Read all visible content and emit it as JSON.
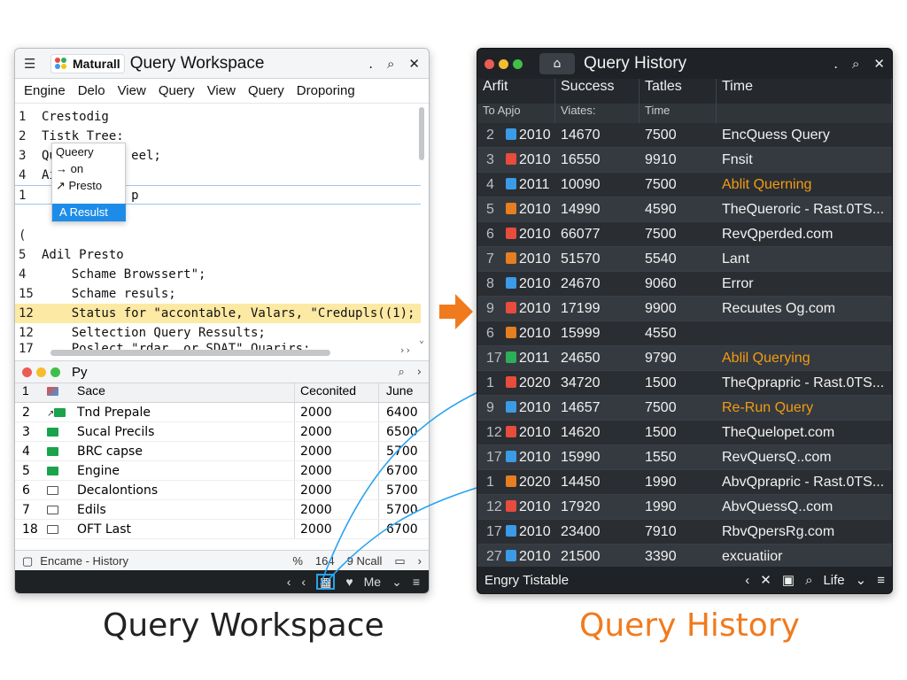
{
  "left_window": {
    "app_name": "Maturall",
    "title": "Query Workspace",
    "title_controls": [
      ".",
      "⌕",
      "✕"
    ],
    "menu": [
      "Engine",
      "Delo",
      "View",
      "Query",
      "View",
      "Query",
      "Droporing"
    ],
    "editor_lines": [
      {
        "ln": "1",
        "text": "Crestodig"
      },
      {
        "ln": "2",
        "text": "Tistk Tree:"
      },
      {
        "ln": "3",
        "text": "Queery      eel;"
      },
      {
        "ln": "4",
        "text": "Ai"
      },
      {
        "ln": "1",
        "text": "            p"
      },
      {
        "ln": "(",
        "text": ""
      },
      {
        "ln": "5",
        "text": "Adil Presto"
      },
      {
        "ln": "4",
        "text": "    Schame Browssert\";"
      },
      {
        "ln": "15",
        "text": "    Schame resuls;"
      },
      {
        "ln": "12",
        "text": "    Status for \"accontable, Valars, \"Credupls((1);"
      },
      {
        "ln": "12",
        "text": "    Seltection Query Ressults;"
      },
      {
        "ln": "17",
        "text": "    Poslect \"rdar, or SDAT\" Quarirs;"
      },
      {
        "ln": "23",
        "text": ")"
      }
    ],
    "popup_items": [
      "Queery",
      "→ on",
      "↗ Presto"
    ],
    "popup_active": "A Resulst",
    "sub_title": "Py",
    "files_header": [
      "Sace",
      "Ceconited",
      "June"
    ],
    "files": [
      {
        "n": "1",
        "icon": "image-icon",
        "name": "",
        "c": "",
        "j": ""
      },
      {
        "n": "2",
        "icon": "folder-green",
        "name": "Tnd Prepale",
        "c": "2000",
        "j": "6400"
      },
      {
        "n": "3",
        "icon": "folder-green",
        "name": "Sucal Precils",
        "c": "2000",
        "j": "6500"
      },
      {
        "n": "4",
        "icon": "folder-green",
        "name": "BRC capse",
        "c": "2000",
        "j": "5700"
      },
      {
        "n": "5",
        "icon": "folder-green",
        "name": "Engine",
        "c": "2000",
        "j": "6700"
      },
      {
        "n": "6",
        "icon": "folder-outline",
        "name": "Decalontions",
        "c": "2000",
        "j": "5700"
      },
      {
        "n": "7",
        "icon": "folder-outline",
        "name": "Edils",
        "c": "2000",
        "j": "5700"
      },
      {
        "n": "18",
        "icon": "folder-outline",
        "name": "OFT Last",
        "c": "2000",
        "j": "6700"
      }
    ],
    "status_left": "Encame - History",
    "status_right": [
      "164",
      "9  Ncall"
    ],
    "bottom_label": "Me"
  },
  "right_window": {
    "title": "Query History",
    "headers": [
      "Arfit",
      "Success",
      "Tatles",
      "Time"
    ],
    "subheaders": [
      "To Apjo",
      "Viates:",
      "Time",
      ""
    ],
    "rows": [
      {
        "n": "2",
        "icon": "b",
        "year": "2010",
        "s": "14670",
        "t": "7500",
        "d": "EncQuess Query",
        "hl": false
      },
      {
        "n": "3",
        "icon": "r",
        "year": "2010",
        "s": "16550",
        "t": "9910",
        "d": "Fnsit",
        "hl": false
      },
      {
        "n": "4",
        "icon": "b",
        "year": "2011",
        "s": "10090",
        "t": "7500",
        "d": "Ablit Querning",
        "hl": true
      },
      {
        "n": "5",
        "icon": "o",
        "year": "2010",
        "s": "14990",
        "t": "4590",
        "d": "TheQueroric - Rast.0TS...",
        "hl": false
      },
      {
        "n": "6",
        "icon": "r",
        "year": "2010",
        "s": "66077",
        "t": "7500",
        "d": "RevQperded.com",
        "hl": false
      },
      {
        "n": "7",
        "icon": "o",
        "year": "2010",
        "s": "51570",
        "t": "5540",
        "d": "Lant",
        "hl": false
      },
      {
        "n": "8",
        "icon": "b",
        "year": "2010",
        "s": "24670",
        "t": "9060",
        "d": "Error",
        "hl": false
      },
      {
        "n": "9",
        "icon": "r",
        "year": "2010",
        "s": "17199",
        "t": "9900",
        "d": "Recuutes Og.com",
        "hl": false
      },
      {
        "n": "6",
        "icon": "o",
        "year": "2010",
        "s": "15999",
        "t": "4550",
        "d": "",
        "hl": false
      },
      {
        "n": "17",
        "icon": "g",
        "year": "2011",
        "s": "24650",
        "t": "9790",
        "d": "Ablil Querying",
        "hl": true
      },
      {
        "n": "1",
        "icon": "r",
        "year": "2020",
        "s": "34720",
        "t": "1500",
        "d": "TheQprapric - Rast.0TS...",
        "hl": false
      },
      {
        "n": "9",
        "icon": "b",
        "year": "2010",
        "s": "14657",
        "t": "7500",
        "d": "Re-Run Query",
        "hl": true
      },
      {
        "n": "12",
        "icon": "r",
        "year": "2010",
        "s": "14620",
        "t": "1500",
        "d": "TheQuelopet.com",
        "hl": false
      },
      {
        "n": "17",
        "icon": "b",
        "year": "2010",
        "s": "15990",
        "t": "1550",
        "d": "RevQuersQ..com",
        "hl": false
      },
      {
        "n": "1",
        "icon": "o",
        "year": "2020",
        "s": "14450",
        "t": "1990",
        "d": "AbvQprapric - Rast.0TS...",
        "hl": false
      },
      {
        "n": "12",
        "icon": "r",
        "year": "2010",
        "s": "17920",
        "t": "1990",
        "d": "AbvQuessQ..com",
        "hl": false
      },
      {
        "n": "17",
        "icon": "b",
        "year": "2010",
        "s": "23400",
        "t": "7910",
        "d": "RbvQpersRg.com",
        "hl": false
      },
      {
        "n": "27",
        "icon": "b",
        "year": "2010",
        "s": "21500",
        "t": "3390",
        "d": "excuatiior",
        "hl": false
      }
    ],
    "bottom_left": "Engry Tistable",
    "bottom_right_label": "Life"
  },
  "captions": {
    "left": "Query Workspace",
    "right": "Query History"
  },
  "colors": {
    "accent_orange": "#f07b1f",
    "accent_blue": "#1d8ce8",
    "highlight_line": "#fce9a4"
  }
}
